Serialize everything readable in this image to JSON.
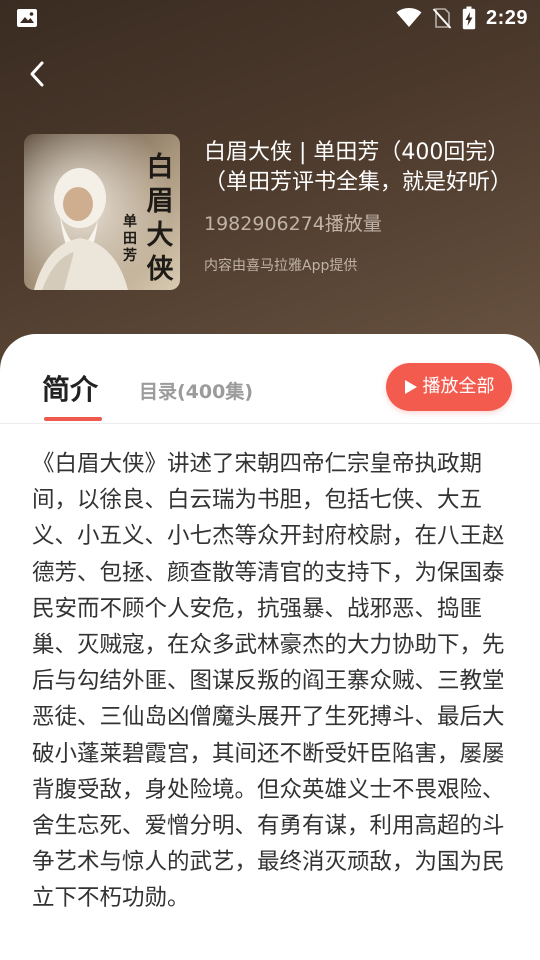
{
  "status_bar": {
    "time": "2:29",
    "icons": [
      "image-icon",
      "wifi-icon",
      "no-sim-icon",
      "battery-charging-icon"
    ]
  },
  "header": {
    "back_icon": "chevron-left-icon"
  },
  "album": {
    "cover_text": {
      "main": "白眉大侠",
      "sub": "单田芳"
    },
    "title": "白眉大侠 | 单田芳（400回完）（单田芳评书全集，就是好听）",
    "play_count": "1982906274播放量",
    "provider": "内容由喜马拉雅App提供"
  },
  "tabs": {
    "intro": "简介",
    "catalog": "目录(400集)"
  },
  "play_all": {
    "label": "播放全部",
    "icon": "play-icon"
  },
  "description": "《白眉大侠》讲述了宋朝四帝仁宗皇帝执政期间，以徐良、白云瑞为书胆，包括七侠、大五义、小五义、小七杰等众开封府校尉，在八王赵德芳、包拯、颜查散等清官的支持下，为保国泰民安而不顾个人安危，抗强暴、战邪恶、捣匪巢、灭贼寇，在众多武林豪杰的大力协助下，先后与勾结外匪、图谋反叛的阎王寨众贼、三教堂恶徒、三仙岛凶僧魔头展开了生死搏斗、最后大破小蓬莱碧霞宫，其间还不断受奸臣陷害，屡屡背腹受敌，身处险境。但众英雄义士不畏艰险、舍生忘死、爱憎分明、有勇有谋，利用高超的斗争艺术与惊人的武艺，最终消灭顽敌，为国为民立下不朽功勋。",
  "colors": {
    "header_dark": "#3a2c22",
    "accent": "#f35b4f",
    "text_dark": "#333333",
    "text_muted": "#9b9b9b"
  }
}
